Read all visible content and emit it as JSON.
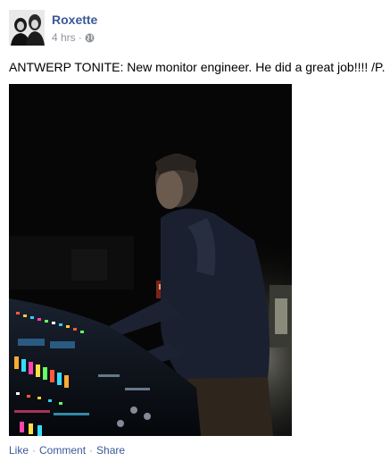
{
  "post": {
    "author": "Roxette",
    "time": "4 hrs",
    "time_separator": "·",
    "privacy_icon": "globe-icon",
    "message": "ANTWERP TONITE: New monitor engineer. He did a great job!!!! /P."
  },
  "actions": {
    "like": "Like",
    "comment": "Comment",
    "share": "Share",
    "separator": "·"
  },
  "colors": {
    "link": "#3b5998",
    "meta": "#90949c"
  }
}
